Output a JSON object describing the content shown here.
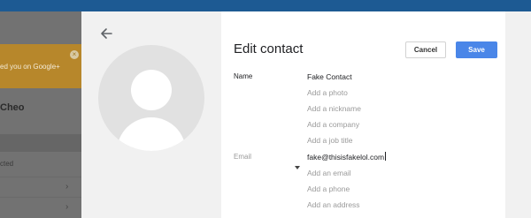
{
  "background": {
    "banner_text": "ed you on Google+",
    "name_partial": "Cheo",
    "status_partial": "cted"
  },
  "dialog": {
    "title": "Edit contact",
    "cancel_label": "Cancel",
    "save_label": "Save",
    "labels": {
      "name": "Name",
      "email": "Email"
    },
    "fields": {
      "name_value": "Fake Contact",
      "add_photo": "Add a photo",
      "add_nickname": "Add a nickname",
      "add_company": "Add a company",
      "add_job_title": "Add a job title",
      "email_value": "fake@thisisfakelol.com",
      "add_email": "Add an email",
      "add_phone": "Add a phone",
      "add_address": "Add an address"
    }
  },
  "colors": {
    "save_button": "#4a86e8",
    "top_bar": "#1d5a93",
    "banner": "#b7872b",
    "overlay_dim": "#727272"
  },
  "icons": {
    "back": "arrow-left-icon",
    "avatar": "person-silhouette-icon",
    "dropdown": "caret-down-icon",
    "banner_close": "close-icon",
    "row_chevron": "chevron-right-icon"
  }
}
